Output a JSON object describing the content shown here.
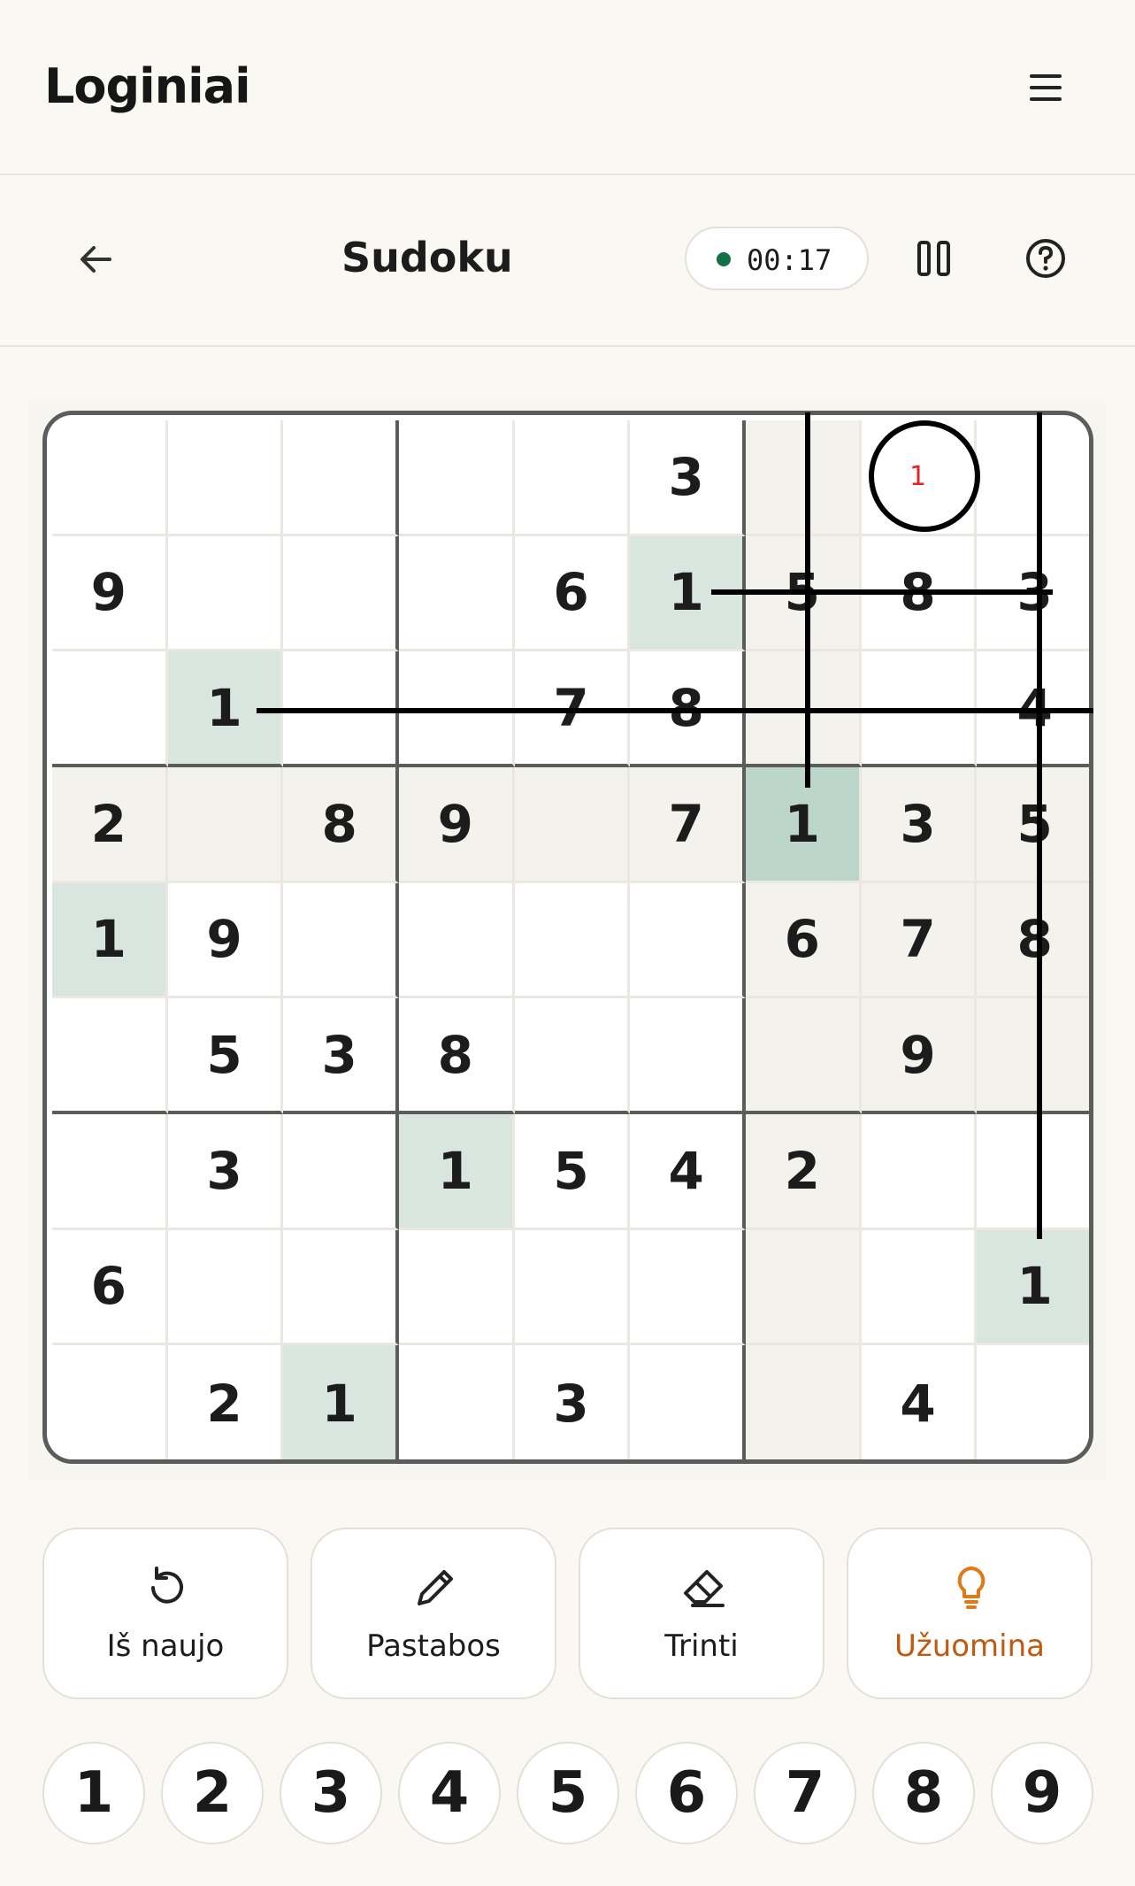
{
  "app": {
    "title": "Loginiai"
  },
  "game": {
    "title": "Sudoku",
    "timer": "00:17",
    "timer_dot_color": "#127046"
  },
  "board": {
    "rows": [
      [
        "",
        "",
        "",
        "",
        "",
        "3",
        "",
        "",
        ""
      ],
      [
        "9",
        "",
        "",
        "",
        "6",
        "1",
        "5",
        "8",
        "3"
      ],
      [
        "",
        "1",
        "",
        "",
        "7",
        "8",
        "",
        "",
        "4"
      ],
      [
        "2",
        "",
        "8",
        "9",
        "",
        "7",
        "1",
        "3",
        "5"
      ],
      [
        "1",
        "9",
        "",
        "",
        "",
        "",
        "6",
        "7",
        "8"
      ],
      [
        "",
        "5",
        "3",
        "8",
        "",
        "",
        "",
        "9",
        ""
      ],
      [
        "",
        "3",
        "",
        "1",
        "5",
        "4",
        "2",
        "",
        ""
      ],
      [
        "6",
        "",
        "",
        "",
        "",
        "",
        "",
        "",
        "1"
      ],
      [
        "",
        "2",
        "1",
        "",
        "3",
        "",
        "",
        "4",
        ""
      ]
    ],
    "note_cell": {
      "row": 0,
      "col": 7,
      "value": "1"
    },
    "selected_cell": {
      "row": 3,
      "col": 6
    },
    "highlight_color": "#f4f2ec",
    "same_number_color": "#d9e6e0",
    "selected_color": "#bdd6cc"
  },
  "actions": [
    {
      "label": "Iš naujo",
      "icon": "restart-icon"
    },
    {
      "label": "Pastabos",
      "icon": "pencil-icon"
    },
    {
      "label": "Trinti",
      "icon": "eraser-icon"
    },
    {
      "label": "Užuomina",
      "icon": "lightbulb-icon"
    }
  ],
  "numpad": [
    "1",
    "2",
    "3",
    "4",
    "5",
    "6",
    "7",
    "8",
    "9"
  ]
}
